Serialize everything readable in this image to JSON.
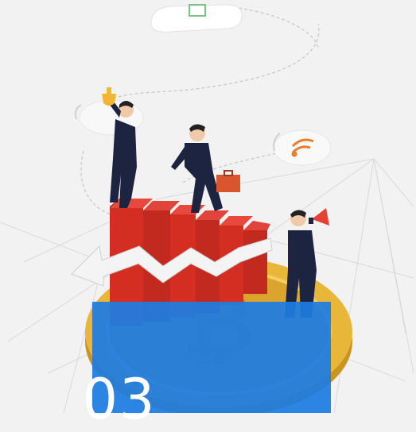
{
  "scene": {
    "description_icons": [
      "cloud-icon",
      "wifi-icon",
      "trophy-icon",
      "megaphone-icon",
      "briefcase-icon",
      "bitcoin-coin"
    ],
    "colors": {
      "background": "#f2f2f2",
      "bar_red": "#d42e22",
      "coin_gold": "#e8b73a",
      "panel_blue": "#1d7de2",
      "suit_navy": "#1d2440"
    }
  },
  "panel": {
    "number": "03"
  }
}
